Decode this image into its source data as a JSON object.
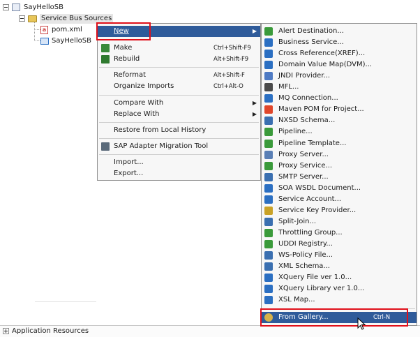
{
  "tree": {
    "root": "SayHelloSB",
    "folder": "Service Bus Sources",
    "files": [
      "pom.xml",
      "SayHelloSB"
    ],
    "bottom_panel": "Application Resources"
  },
  "context_menu": {
    "new": "New",
    "make": "Make",
    "make_shortcut": "Ctrl+Shift-F9",
    "rebuild": "Rebuild",
    "rebuild_shortcut": "Alt+Shift-F9",
    "reformat": "Reformat",
    "reformat_shortcut": "Alt+Shift-F",
    "organize_imports": "Organize Imports",
    "organize_imports_shortcut": "Ctrl+Alt-O",
    "compare_with": "Compare With",
    "replace_with": "Replace With",
    "restore": "Restore from Local History",
    "sap": "SAP Adapter Migration Tool",
    "import": "Import...",
    "export": "Export..."
  },
  "new_submenu": {
    "items": [
      {
        "label": "Alert Destination...",
        "icon": "alert-destination-icon",
        "color": "#3a9a3a"
      },
      {
        "label": "Business Service...",
        "icon": "business-service-icon",
        "color": "#2b6fc2"
      },
      {
        "label": "Cross Reference(XREF)...",
        "icon": "cross-reference-icon",
        "color": "#2b6fc2"
      },
      {
        "label": "Domain Value Map(DVM)...",
        "icon": "domain-value-map-icon",
        "color": "#2b6fc2"
      },
      {
        "label": "JNDI Provider...",
        "icon": "jndi-provider-icon",
        "color": "#4f7bc4"
      },
      {
        "label": "MFL...",
        "icon": "mfl-icon",
        "color": "#4a4a4a"
      },
      {
        "label": "MQ Connection...",
        "icon": "mq-connection-icon",
        "color": "#2b6fc2"
      },
      {
        "label": "Maven POM for Project...",
        "icon": "maven-pom-icon",
        "color": "#e0462a"
      },
      {
        "label": "NXSD Schema...",
        "icon": "nxsd-schema-icon",
        "color": "#3a6fb0"
      },
      {
        "label": "Pipeline...",
        "icon": "pipeline-icon",
        "color": "#3a9a3a"
      },
      {
        "label": "Pipeline Template...",
        "icon": "pipeline-template-icon",
        "color": "#3a9a3a"
      },
      {
        "label": "Proxy Server...",
        "icon": "proxy-server-icon",
        "color": "#5a7fb5"
      },
      {
        "label": "Proxy Service...",
        "icon": "proxy-service-icon",
        "color": "#3a9a3a"
      },
      {
        "label": "SMTP Server...",
        "icon": "smtp-server-icon",
        "color": "#3a6fb0"
      },
      {
        "label": "SOA WSDL Document...",
        "icon": "soa-wsdl-icon",
        "color": "#2b6fc2"
      },
      {
        "label": "Service Account...",
        "icon": "service-account-icon",
        "color": "#2b6fc2"
      },
      {
        "label": "Service Key Provider...",
        "icon": "service-key-provider-icon",
        "color": "#c9a227"
      },
      {
        "label": "Split-Join...",
        "icon": "split-join-icon",
        "color": "#3a6fb0"
      },
      {
        "label": "Throttling Group...",
        "icon": "throttling-group-icon",
        "color": "#3a9a3a"
      },
      {
        "label": "UDDI Registry...",
        "icon": "uddi-registry-icon",
        "color": "#3a9a3a"
      },
      {
        "label": "WS-Policy File...",
        "icon": "ws-policy-icon",
        "color": "#3a6fb0"
      },
      {
        "label": "XML Schema...",
        "icon": "xml-schema-icon",
        "color": "#3a6fb0"
      },
      {
        "label": "XQuery File ver 1.0...",
        "icon": "xquery-file-icon",
        "color": "#2b6fc2"
      },
      {
        "label": "XQuery Library ver 1.0...",
        "icon": "xquery-library-icon",
        "color": "#2b6fc2"
      },
      {
        "label": "XSL Map...",
        "icon": "xsl-map-icon",
        "color": "#2b6fc2"
      }
    ],
    "gallery": "From Gallery...",
    "gallery_shortcut": "Ctrl-N"
  },
  "colors": {
    "selection": "#2f5b9a",
    "highlight_box": "#e0101a",
    "menu_bg": "#f7f7f7"
  }
}
